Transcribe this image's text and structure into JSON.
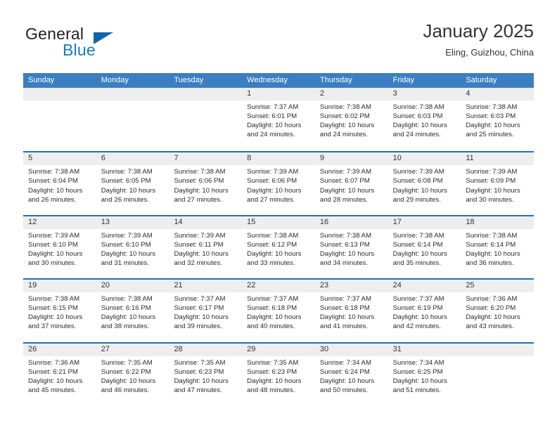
{
  "brand": {
    "name_part1": "General",
    "name_part2": "Blue",
    "logo_icon": "triangle-logo-icon"
  },
  "header": {
    "month_title": "January 2025",
    "location": "Eling, Guizhou, China"
  },
  "calendar": {
    "weekdays": [
      "Sunday",
      "Monday",
      "Tuesday",
      "Wednesday",
      "Thursday",
      "Friday",
      "Saturday"
    ],
    "colors": {
      "header_blue": "#3c7fc0",
      "row_divider_blue": "#2a6db0",
      "day_number_band": "#eeeeee",
      "brand_blue": "#1c79c0"
    },
    "weeks": [
      [
        {
          "day": "",
          "sunrise": "",
          "sunset": "",
          "daylight_line1": "",
          "daylight_line2": ""
        },
        {
          "day": "",
          "sunrise": "",
          "sunset": "",
          "daylight_line1": "",
          "daylight_line2": ""
        },
        {
          "day": "",
          "sunrise": "",
          "sunset": "",
          "daylight_line1": "",
          "daylight_line2": ""
        },
        {
          "day": "1",
          "sunrise": "Sunrise: 7:37 AM",
          "sunset": "Sunset: 6:01 PM",
          "daylight_line1": "Daylight: 10 hours",
          "daylight_line2": "and 24 minutes."
        },
        {
          "day": "2",
          "sunrise": "Sunrise: 7:38 AM",
          "sunset": "Sunset: 6:02 PM",
          "daylight_line1": "Daylight: 10 hours",
          "daylight_line2": "and 24 minutes."
        },
        {
          "day": "3",
          "sunrise": "Sunrise: 7:38 AM",
          "sunset": "Sunset: 6:03 PM",
          "daylight_line1": "Daylight: 10 hours",
          "daylight_line2": "and 24 minutes."
        },
        {
          "day": "4",
          "sunrise": "Sunrise: 7:38 AM",
          "sunset": "Sunset: 6:03 PM",
          "daylight_line1": "Daylight: 10 hours",
          "daylight_line2": "and 25 minutes."
        }
      ],
      [
        {
          "day": "5",
          "sunrise": "Sunrise: 7:38 AM",
          "sunset": "Sunset: 6:04 PM",
          "daylight_line1": "Daylight: 10 hours",
          "daylight_line2": "and 26 minutes."
        },
        {
          "day": "6",
          "sunrise": "Sunrise: 7:38 AM",
          "sunset": "Sunset: 6:05 PM",
          "daylight_line1": "Daylight: 10 hours",
          "daylight_line2": "and 26 minutes."
        },
        {
          "day": "7",
          "sunrise": "Sunrise: 7:38 AM",
          "sunset": "Sunset: 6:06 PM",
          "daylight_line1": "Daylight: 10 hours",
          "daylight_line2": "and 27 minutes."
        },
        {
          "day": "8",
          "sunrise": "Sunrise: 7:39 AM",
          "sunset": "Sunset: 6:06 PM",
          "daylight_line1": "Daylight: 10 hours",
          "daylight_line2": "and 27 minutes."
        },
        {
          "day": "9",
          "sunrise": "Sunrise: 7:39 AM",
          "sunset": "Sunset: 6:07 PM",
          "daylight_line1": "Daylight: 10 hours",
          "daylight_line2": "and 28 minutes."
        },
        {
          "day": "10",
          "sunrise": "Sunrise: 7:39 AM",
          "sunset": "Sunset: 6:08 PM",
          "daylight_line1": "Daylight: 10 hours",
          "daylight_line2": "and 29 minutes."
        },
        {
          "day": "11",
          "sunrise": "Sunrise: 7:39 AM",
          "sunset": "Sunset: 6:09 PM",
          "daylight_line1": "Daylight: 10 hours",
          "daylight_line2": "and 30 minutes."
        }
      ],
      [
        {
          "day": "12",
          "sunrise": "Sunrise: 7:39 AM",
          "sunset": "Sunset: 6:10 PM",
          "daylight_line1": "Daylight: 10 hours",
          "daylight_line2": "and 30 minutes."
        },
        {
          "day": "13",
          "sunrise": "Sunrise: 7:39 AM",
          "sunset": "Sunset: 6:10 PM",
          "daylight_line1": "Daylight: 10 hours",
          "daylight_line2": "and 31 minutes."
        },
        {
          "day": "14",
          "sunrise": "Sunrise: 7:39 AM",
          "sunset": "Sunset: 6:11 PM",
          "daylight_line1": "Daylight: 10 hours",
          "daylight_line2": "and 32 minutes."
        },
        {
          "day": "15",
          "sunrise": "Sunrise: 7:38 AM",
          "sunset": "Sunset: 6:12 PM",
          "daylight_line1": "Daylight: 10 hours",
          "daylight_line2": "and 33 minutes."
        },
        {
          "day": "16",
          "sunrise": "Sunrise: 7:38 AM",
          "sunset": "Sunset: 6:13 PM",
          "daylight_line1": "Daylight: 10 hours",
          "daylight_line2": "and 34 minutes."
        },
        {
          "day": "17",
          "sunrise": "Sunrise: 7:38 AM",
          "sunset": "Sunset: 6:14 PM",
          "daylight_line1": "Daylight: 10 hours",
          "daylight_line2": "and 35 minutes."
        },
        {
          "day": "18",
          "sunrise": "Sunrise: 7:38 AM",
          "sunset": "Sunset: 6:14 PM",
          "daylight_line1": "Daylight: 10 hours",
          "daylight_line2": "and 36 minutes."
        }
      ],
      [
        {
          "day": "19",
          "sunrise": "Sunrise: 7:38 AM",
          "sunset": "Sunset: 6:15 PM",
          "daylight_line1": "Daylight: 10 hours",
          "daylight_line2": "and 37 minutes."
        },
        {
          "day": "20",
          "sunrise": "Sunrise: 7:38 AM",
          "sunset": "Sunset: 6:16 PM",
          "daylight_line1": "Daylight: 10 hours",
          "daylight_line2": "and 38 minutes."
        },
        {
          "day": "21",
          "sunrise": "Sunrise: 7:37 AM",
          "sunset": "Sunset: 6:17 PM",
          "daylight_line1": "Daylight: 10 hours",
          "daylight_line2": "and 39 minutes."
        },
        {
          "day": "22",
          "sunrise": "Sunrise: 7:37 AM",
          "sunset": "Sunset: 6:18 PM",
          "daylight_line1": "Daylight: 10 hours",
          "daylight_line2": "and 40 minutes."
        },
        {
          "day": "23",
          "sunrise": "Sunrise: 7:37 AM",
          "sunset": "Sunset: 6:18 PM",
          "daylight_line1": "Daylight: 10 hours",
          "daylight_line2": "and 41 minutes."
        },
        {
          "day": "24",
          "sunrise": "Sunrise: 7:37 AM",
          "sunset": "Sunset: 6:19 PM",
          "daylight_line1": "Daylight: 10 hours",
          "daylight_line2": "and 42 minutes."
        },
        {
          "day": "25",
          "sunrise": "Sunrise: 7:36 AM",
          "sunset": "Sunset: 6:20 PM",
          "daylight_line1": "Daylight: 10 hours",
          "daylight_line2": "and 43 minutes."
        }
      ],
      [
        {
          "day": "26",
          "sunrise": "Sunrise: 7:36 AM",
          "sunset": "Sunset: 6:21 PM",
          "daylight_line1": "Daylight: 10 hours",
          "daylight_line2": "and 45 minutes."
        },
        {
          "day": "27",
          "sunrise": "Sunrise: 7:35 AM",
          "sunset": "Sunset: 6:22 PM",
          "daylight_line1": "Daylight: 10 hours",
          "daylight_line2": "and 46 minutes."
        },
        {
          "day": "28",
          "sunrise": "Sunrise: 7:35 AM",
          "sunset": "Sunset: 6:23 PM",
          "daylight_line1": "Daylight: 10 hours",
          "daylight_line2": "and 47 minutes."
        },
        {
          "day": "29",
          "sunrise": "Sunrise: 7:35 AM",
          "sunset": "Sunset: 6:23 PM",
          "daylight_line1": "Daylight: 10 hours",
          "daylight_line2": "and 48 minutes."
        },
        {
          "day": "30",
          "sunrise": "Sunrise: 7:34 AM",
          "sunset": "Sunset: 6:24 PM",
          "daylight_line1": "Daylight: 10 hours",
          "daylight_line2": "and 50 minutes."
        },
        {
          "day": "31",
          "sunrise": "Sunrise: 7:34 AM",
          "sunset": "Sunset: 6:25 PM",
          "daylight_line1": "Daylight: 10 hours",
          "daylight_line2": "and 51 minutes."
        },
        {
          "day": "",
          "sunrise": "",
          "sunset": "",
          "daylight_line1": "",
          "daylight_line2": ""
        }
      ]
    ]
  }
}
